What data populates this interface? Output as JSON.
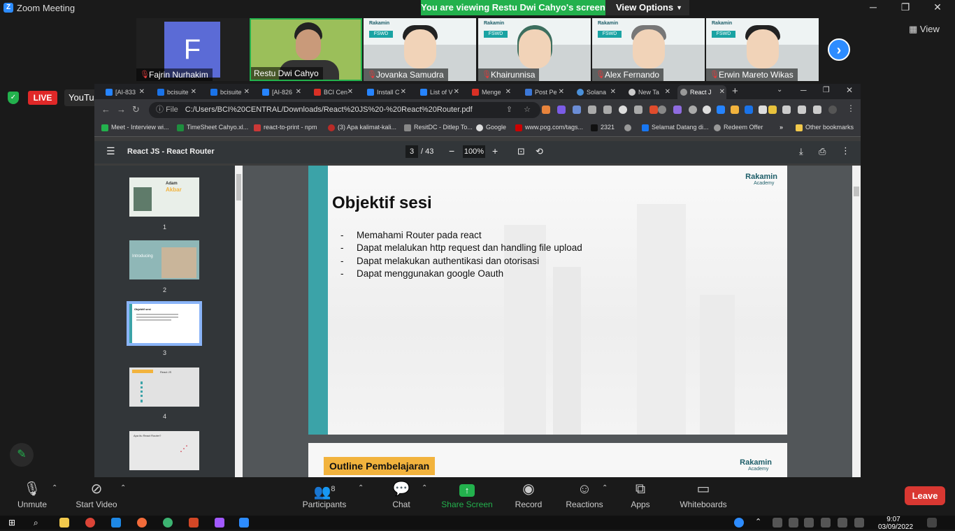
{
  "zoom": {
    "title": "Zoom Meeting",
    "banner": "You are viewing Restu Dwi Cahyo's screen",
    "view_options": "View Options",
    "view_label": "View",
    "participants": [
      {
        "name": "Fajrin Nurhakim",
        "initial": "F"
      },
      {
        "name": "Restu Dwi Cahyo"
      },
      {
        "name": "Jovanka Samudra"
      },
      {
        "name": "Khairunnisa"
      },
      {
        "name": "Alex Fernando"
      },
      {
        "name": "Erwin Mareto Wikas"
      }
    ],
    "thumb_brand": "Rakamin",
    "thumb_badge": "FSWD",
    "live": "LIVE",
    "youtube": "YouTube",
    "toolbar": {
      "unmute": "Unmute",
      "start_video": "Start Video",
      "participants": "Participants",
      "participants_count": "8",
      "chat": "Chat",
      "share_screen": "Share Screen",
      "record": "Record",
      "reactions": "Reactions",
      "apps": "Apps",
      "whiteboards": "Whiteboards",
      "leave": "Leave"
    }
  },
  "browser": {
    "tabs": [
      "[AI-833",
      "bcisuite",
      "bcisuite",
      "[AI-826",
      "BCI Cen",
      "Install C",
      "List of V",
      "Menge",
      "Post Pe",
      "Solana",
      "New Ta",
      "React J"
    ],
    "url_label": "File",
    "url": "C:/Users/BCI%20CENTRAL/Downloads/React%20JS%20-%20React%20Router.pdf",
    "bookmarks": [
      "Meet - Interview wi...",
      "TimeSheet Cahyo.xl...",
      "react-to-print - npm",
      "(3) Apa kalimat-kali...",
      "ResitDC - Ditlep To...",
      "Google",
      "www.pog.com/tags...",
      "2321",
      "Selamat Datang di...",
      "Redeem Offer",
      "Other bookmarks"
    ]
  },
  "pdf": {
    "title": "React JS - React Router",
    "page": "3",
    "total": "/ 43",
    "zoom": "100%",
    "thumbs": [
      "1",
      "2",
      "3",
      "4"
    ],
    "thumb1_name_a": "Adam",
    "thumb1_name_b": "Akbar",
    "thumb2_text": "Introducing",
    "thumb3_text": "Objektif sesi",
    "thumb4_text": "React JS",
    "thumb5_text": "Apa itu React Router?",
    "slide_title": "Objektif sesi",
    "objectives": [
      "Memahami Router pada react",
      "Dapat melalukan http request dan handling file upload",
      "Dapat melakukan authentikasi dan otorisasi",
      "Dapat menggunakan google Oauth"
    ],
    "bullet": "-",
    "logo": "Rakamin",
    "logo_sub": "Academy",
    "outline": "Outline Pembelajaran"
  },
  "taskbar": {
    "time": "9:07",
    "date": "03/09/2022"
  }
}
